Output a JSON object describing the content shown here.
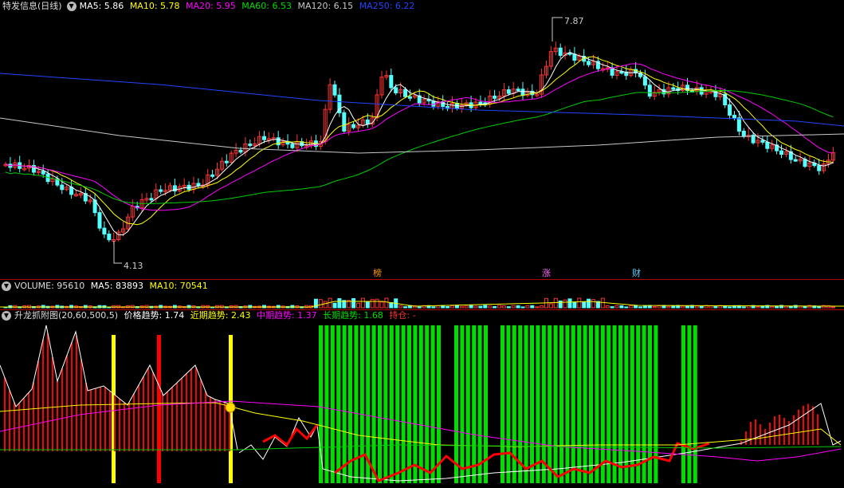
{
  "price_header": {
    "title": "特发信息(日线)",
    "ma5_label": "MA5: 5.86",
    "ma10_label": "MA10: 5.78",
    "ma20_label": "MA20: 5.95",
    "ma60_label": "MA60: 6.53",
    "ma120_label": "MA120: 6.15",
    "ma250_label": "MA250: 6.22"
  },
  "price_annotations": {
    "high": "7.87",
    "low": "4.13"
  },
  "event_markers": {
    "bang": "榜",
    "zhang": "涨",
    "cai": "财"
  },
  "volume_header": {
    "volume_label": "VOLUME: 95610",
    "ma5_label": "MA5: 83893",
    "ma10_label": "MA10: 70541"
  },
  "indicator_header": {
    "name": "升龙抓附图(20,60,500,5)",
    "price_trend": "价格趋势: 1.74",
    "short_trend": "近期趋势: 2.43",
    "mid_trend": "中期趋势: 1.37",
    "long_trend": "长期趋势: 1.68",
    "position": "持仓: -"
  },
  "colors": {
    "up": "#ff3232",
    "down": "#54ffff",
    "ma5": "#ffffff",
    "ma10": "#ffff00",
    "ma20": "#ff00ff",
    "ma60": "#00cc00",
    "ma120": "#c8c8c8",
    "ma250": "#2244ff",
    "signal_green": "#00dd00",
    "signal_yellow": "#ffff00",
    "signal_red": "#ff0000"
  }
}
